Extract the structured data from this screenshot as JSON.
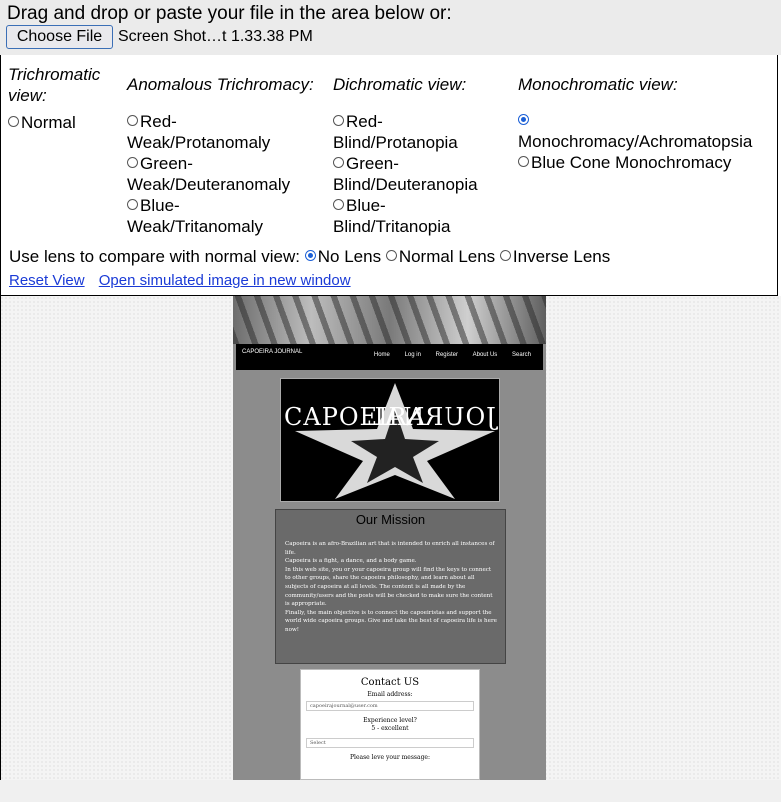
{
  "upload": {
    "instruction": "Drag and drop or paste your file in the area below or:",
    "choose_label": "Choose File",
    "file_name": "Screen Shot…t 1.33.38 PM"
  },
  "columns": {
    "trichromatic": {
      "heading_line1": "Trichromatic",
      "heading_line2": "view:",
      "options": [
        "Normal"
      ]
    },
    "anomalous": {
      "heading": "Anomalous Trichromacy:",
      "options": [
        [
          "Red-",
          "Weak/Protanomaly"
        ],
        [
          "Green-",
          "Weak/Deuteranomaly"
        ],
        [
          "Blue-",
          "Weak/Tritanomaly"
        ]
      ]
    },
    "dichromatic": {
      "heading": "Dichromatic view:",
      "options": [
        [
          "Red-",
          "Blind/Protanopia"
        ],
        [
          "Green-",
          "Blind/Deuteranopia"
        ],
        [
          "Blue-",
          "Blind/Tritanopia"
        ]
      ]
    },
    "monochromatic": {
      "heading": "Monochromatic view:",
      "options": [
        "Monochromacy/Achromatopsia",
        "Blue Cone Monochromacy"
      ],
      "selected": "Monochromacy/Achromatopsia"
    }
  },
  "lens": {
    "label": "Use lens to compare with normal view:",
    "options": [
      "No Lens",
      "Normal Lens",
      "Inverse Lens"
    ],
    "selected": "No Lens"
  },
  "links": {
    "reset": "Reset View",
    "open_new": "Open simulated image in new window"
  },
  "preview": {
    "logo_text": "CAPOEIRA JOURNAL",
    "nav": [
      "Home",
      "Log in",
      "Register",
      "About Us",
      "Search"
    ],
    "hero_left": "CAPOEIRA",
    "hero_right": "JOURNAL",
    "mission_title": "Our Mission",
    "mission_paragraphs": [
      "Capoeira is an afro-Brazilian art that is intended to enrich all instances of life.",
      "Capoeira is a fight, a dance, and a body game.",
      "In this web site, you or your capoeira group will find the keys to connect to other groups, share the capoeira philosophy, and learn about all subjects of capoeira at all levels. The content is all made by the community/users and the posts will be checked to make sure the content is appropriate.",
      "Finally, the main objective is to connect the capoeiristas and support the world wide capoeira groups. Give and take the best of capoeira life is here now!"
    ],
    "contact_title": "Contact US",
    "email_label": "Email address:",
    "email_value": "capoeirajournal@user.com",
    "experience_label": "Experience level?",
    "experience_hint": "5 - excellent",
    "select_value": "Select",
    "message_label": "Please leve your message:"
  },
  "colors": {
    "radio_selected": "#1a5fd6",
    "link": "#1a3ad6"
  }
}
